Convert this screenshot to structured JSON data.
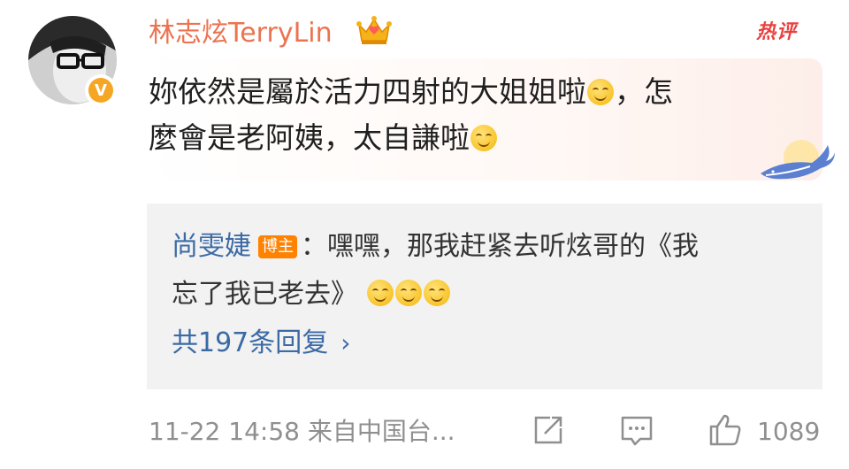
{
  "comment": {
    "username": "林志炫TerryLin",
    "hot_label": "热评",
    "text_line1": "妳依然是屬於活力四射的大姐姐啦",
    "text_line1_end": "，怎",
    "text_line2": "麼會是老阿姨，太自謙啦",
    "emoji_names": [
      "smile-emoji"
    ]
  },
  "reply": {
    "author": "尚雯婕",
    "badge": "博主",
    "text_line1": "：嘿嘿，那我赶紧去听炫哥的《我",
    "text_line2": "忘了我已老去》",
    "more_replies": "共197条回复"
  },
  "footer": {
    "time_source": "11-22 14:58 来自中国台...",
    "like_count": "1089"
  },
  "colors": {
    "username": "#eb7350",
    "link_blue": "#3c6aa5",
    "hot": "#e8423f",
    "badge": "#ff8200",
    "meta_gray": "#8f8f8f"
  }
}
